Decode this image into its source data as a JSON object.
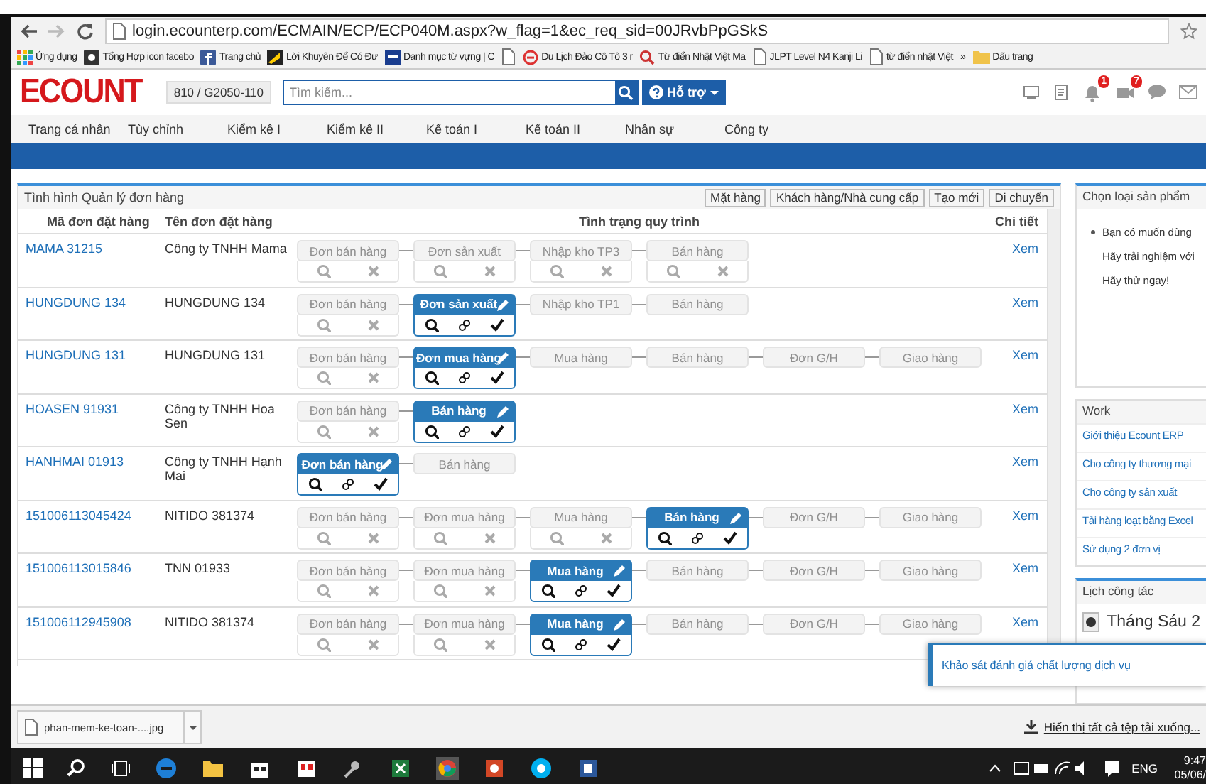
{
  "browser": {
    "url": "login.ecounterp.com/ECMAIN/ECP/ECP040M.aspx?w_flag=1&ec_req_sid=00JRvbPpGSkS",
    "bookmarks": [
      {
        "kind": "apps",
        "label": "Ứng dụng"
      },
      {
        "kind": "dark-tile",
        "label": "Tổng Hợp icon facebo"
      },
      {
        "kind": "fb-tile",
        "label": "Trang chủ"
      },
      {
        "kind": "yellow-tile",
        "label": "Lời Khuyên Để Có Đư"
      },
      {
        "kind": "blue-tile",
        "label": "Danh mục từ vựng | C"
      },
      {
        "kind": "page"
      },
      {
        "kind": "no-entry",
        "label": "Du Lịch Đảo Cô Tô 3 r"
      },
      {
        "kind": "search",
        "label": "Từ điển Nhật Việt Ma"
      },
      {
        "kind": "page",
        "label": "JLPT Level N4 Kanji Li"
      },
      {
        "kind": "page",
        "label": "từ điển nhật Việt"
      },
      {
        "kind": "more",
        "label": "»"
      },
      {
        "kind": "folder",
        "label": "Dấu trang"
      }
    ]
  },
  "header": {
    "logo": "ECOUNT",
    "company_code": "810 / G2050-110",
    "search": {
      "placeholder": "Tìm kiếm..."
    },
    "help_button": "Hỗ trợ",
    "badges": [
      "1",
      "7"
    ]
  },
  "menu": [
    "Trang cá nhân",
    "Tùy chỉnh",
    "Kiểm kê I",
    "Kiểm kê II",
    "Kế toán I",
    "Kế toán II",
    "Nhân sự",
    "Công ty"
  ],
  "panel": {
    "title": "Tình hình Quản lý đơn hàng",
    "buttons": [
      "Mặt hàng",
      "Khách hàng/Nhà cung cấp",
      "Tạo mới",
      "Di chuyển"
    ],
    "columns": [
      "Mã đơn đặt hàng",
      "Tên đơn đặt hàng",
      "Tình trạng quy trình",
      "Chi tiết"
    ],
    "rows": [
      {
        "code": "MAMA 31215",
        "name": "Công ty TNHH Mama",
        "detail": "Xem",
        "steps": [
          {
            "label": "Đơn bán hàng",
            "active": false,
            "tools": true
          },
          {
            "label": "Đơn sản xuất",
            "active": false,
            "tools": true
          },
          {
            "label": "Nhập kho TP3",
            "active": false,
            "tools": true
          },
          {
            "label": "Bán hàng",
            "active": false,
            "tools": true
          }
        ]
      },
      {
        "code": "HUNGDUNG 134",
        "name": "HUNGDUNG 134",
        "detail": "Xem",
        "steps": [
          {
            "label": "Đơn bán hàng",
            "active": false,
            "tools": true
          },
          {
            "label": "Đơn sản xuất",
            "active": true,
            "tools": true
          },
          {
            "label": "Nhập kho TP1",
            "active": false,
            "tools": false
          },
          {
            "label": "Bán hàng",
            "active": false,
            "tools": false
          }
        ]
      },
      {
        "code": "HUNGDUNG 131",
        "name": "HUNGDUNG 131",
        "detail": "Xem",
        "steps": [
          {
            "label": "Đơn bán hàng",
            "active": false,
            "tools": true
          },
          {
            "label": "Đơn mua hàng",
            "active": true,
            "tools": true
          },
          {
            "label": "Mua hàng",
            "active": false,
            "tools": false
          },
          {
            "label": "Bán hàng",
            "active": false,
            "tools": false
          },
          {
            "label": "Đơn G/H",
            "active": false,
            "tools": false
          },
          {
            "label": "Giao hàng",
            "active": false,
            "tools": false
          }
        ]
      },
      {
        "code": "HOASEN 91931",
        "name": "Công ty TNHH Hoa Sen",
        "detail": "Xem",
        "steps": [
          {
            "label": "Đơn bán hàng",
            "active": false,
            "tools": true
          },
          {
            "label": "Bán hàng",
            "active": true,
            "tools": true
          }
        ]
      },
      {
        "code": "HANHMAI 01913",
        "name": "Công ty TNHH Hạnh Mai",
        "detail": "Xem",
        "steps": [
          {
            "label": "Đơn bán hàng",
            "active": true,
            "tools": true
          },
          {
            "label": "Bán hàng",
            "active": false,
            "tools": false
          }
        ]
      },
      {
        "code": "151006113045424",
        "name": "NITIDO 381374",
        "detail": "Xem",
        "steps": [
          {
            "label": "Đơn bán hàng",
            "active": false,
            "tools": true
          },
          {
            "label": "Đơn mua hàng",
            "active": false,
            "tools": true
          },
          {
            "label": "Mua hàng",
            "active": false,
            "tools": true
          },
          {
            "label": "Bán hàng",
            "active": true,
            "tools": true
          },
          {
            "label": "Đơn G/H",
            "active": false,
            "tools": false
          },
          {
            "label": "Giao hàng",
            "active": false,
            "tools": false
          }
        ]
      },
      {
        "code": "151006113015846",
        "name": "TNN 01933",
        "detail": "Xem",
        "steps": [
          {
            "label": "Đơn bán hàng",
            "active": false,
            "tools": true
          },
          {
            "label": "Đơn mua hàng",
            "active": false,
            "tools": true
          },
          {
            "label": "Mua hàng",
            "active": true,
            "tools": true
          },
          {
            "label": "Bán hàng",
            "active": false,
            "tools": false
          },
          {
            "label": "Đơn G/H",
            "active": false,
            "tools": false
          },
          {
            "label": "Giao hàng",
            "active": false,
            "tools": false
          }
        ]
      },
      {
        "code": "151006112945908",
        "name": "NITIDO 381374",
        "detail": "Xem",
        "steps": [
          {
            "label": "Đơn bán hàng",
            "active": false,
            "tools": true
          },
          {
            "label": "Đơn mua hàng",
            "active": false,
            "tools": true
          },
          {
            "label": "Mua hàng",
            "active": true,
            "tools": true
          },
          {
            "label": "Bán hàng",
            "active": false,
            "tools": false
          },
          {
            "label": "Đơn G/H",
            "active": false,
            "tools": false
          },
          {
            "label": "Giao hàng",
            "active": false,
            "tools": false
          }
        ]
      }
    ]
  },
  "sidebar": {
    "product": {
      "title": "Chọn loại sản phẩm",
      "bullet": "Bạn có muốn dùng",
      "lines": [
        "Hãy trải nghiệm với",
        "Hãy thử ngay!"
      ]
    },
    "work": {
      "title": "Work",
      "links": [
        "Giới thiệu Ecount ERP",
        "Cho công ty thương mại",
        "Cho công ty sản xuất",
        "Tải hàng loạt bằng Excel",
        "Sử dụng 2 đơn vị"
      ]
    },
    "calendar": {
      "title": "Lịch công tác",
      "month": "Tháng Sáu 2"
    }
  },
  "toast": "Khảo sát đánh giá chất lượng dịch vụ",
  "downloads": {
    "file": "phan-mem-ke-toan-....jpg",
    "show_all": "Hiển thị tất cả tệp tải xuống..."
  },
  "taskbar": {
    "language": "ENG",
    "time": "9:47",
    "date": "05/06/"
  }
}
